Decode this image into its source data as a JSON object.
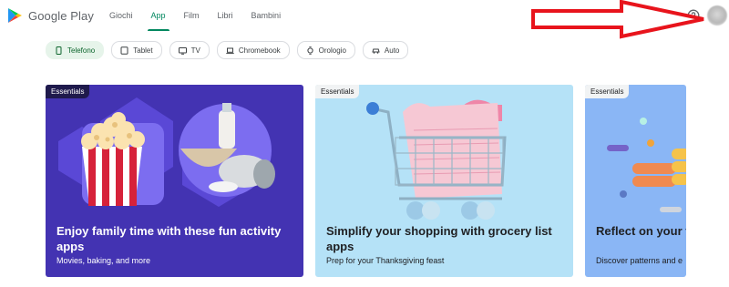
{
  "header": {
    "logo_text": "Google Play",
    "nav": [
      {
        "label": "Giochi",
        "active": false
      },
      {
        "label": "App",
        "active": true
      },
      {
        "label": "Film",
        "active": false
      },
      {
        "label": "Libri",
        "active": false
      },
      {
        "label": "Bambini",
        "active": false
      }
    ],
    "help_icon": "help-circle-icon",
    "avatar_icon": "account-avatar"
  },
  "annotation": {
    "color": "#e8141c",
    "shape": "arrow-pointing-right"
  },
  "chips": [
    {
      "label": "Telefono",
      "icon": "phone-icon",
      "active": true
    },
    {
      "label": "Tablet",
      "icon": "tablet-icon",
      "active": false
    },
    {
      "label": "TV",
      "icon": "tv-icon",
      "active": false
    },
    {
      "label": "Chromebook",
      "icon": "laptop-icon",
      "active": false
    },
    {
      "label": "Orologio",
      "icon": "watch-icon",
      "active": false
    },
    {
      "label": "Auto",
      "icon": "car-icon",
      "active": false
    }
  ],
  "cards": [
    {
      "badge": "Essentials",
      "title": "Enjoy family time with these fun activity apps",
      "subtitle": "Movies, baking, and more",
      "bg": "#4333b2"
    },
    {
      "badge": "Essentials",
      "title": "Simplify your shopping with grocery list apps",
      "subtitle": "Prep for your Thanksgiving feast",
      "bg": "#b5e2f7"
    },
    {
      "badge": "Essentials",
      "title": "Reflect on your f tracking apps",
      "subtitle": "Discover patterns and e",
      "bg": "#8ab6f5"
    }
  ],
  "colors": {
    "accent": "#01875f",
    "active_chip_bg": "#e6f4ea"
  }
}
